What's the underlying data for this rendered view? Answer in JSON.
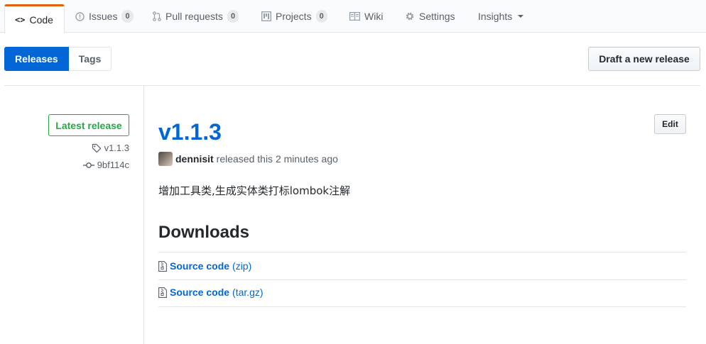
{
  "repo_nav": {
    "tabs": [
      {
        "label": "Code",
        "icon": "code-icon"
      },
      {
        "label": "Issues",
        "icon": "issue-opened-icon",
        "count": "0"
      },
      {
        "label": "Pull requests",
        "icon": "git-pull-request-icon",
        "count": "0"
      },
      {
        "label": "Projects",
        "icon": "project-icon",
        "count": "0"
      },
      {
        "label": "Wiki",
        "icon": "book-icon"
      },
      {
        "label": "Settings",
        "icon": "gear-icon"
      },
      {
        "label": "Insights",
        "icon": "chevron-down-icon"
      }
    ],
    "code_glyph": "<>",
    "accent_color": "#e36209"
  },
  "subnav": {
    "releases_label": "Releases",
    "tags_label": "Tags"
  },
  "actions": {
    "draft_label": "Draft a new release",
    "edit_label": "Edit"
  },
  "release": {
    "badge": "Latest release",
    "tag": "v1.1.3",
    "commit": "9bf114c",
    "title": "v1.1.3",
    "author": "dennisit",
    "released_text": "released this 2 minutes ago",
    "notes": "增加工具类,生成实体类打标lombok注解"
  },
  "downloads": {
    "title": "Downloads",
    "items": [
      {
        "name": "Source code",
        "format": "(zip)"
      },
      {
        "name": "Source code",
        "format": "(tar.gz)"
      }
    ]
  },
  "colors": {
    "link": "#0366d6",
    "success": "#28a745",
    "text": "#24292e",
    "muted": "#586069"
  }
}
